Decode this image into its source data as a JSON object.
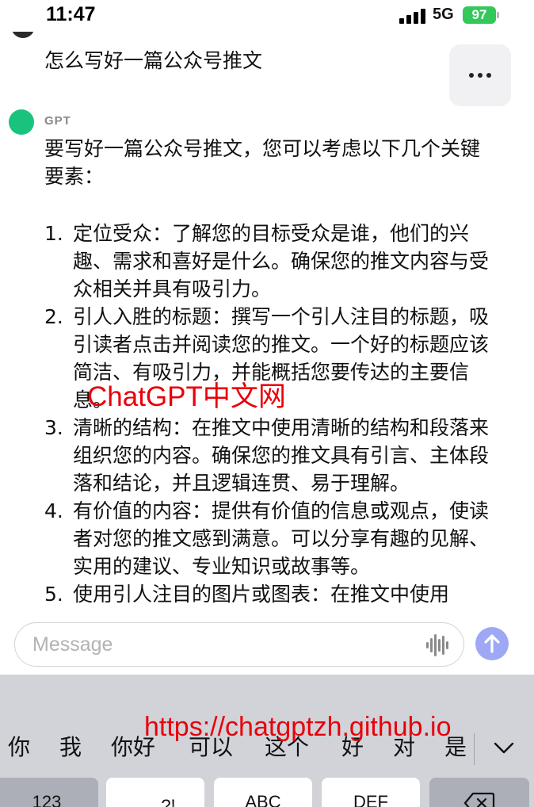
{
  "status_bar": {
    "time": "11:47",
    "network": "5G",
    "battery": "97"
  },
  "chat": {
    "user_message": "怎么写好一篇公众号推文",
    "assistant_name": "GPT",
    "assistant_intro": "要写好一篇公众号推文，您可以考虑以下几个关键要素：",
    "assistant_items": [
      {
        "number": "1.",
        "text": "定位受众：了解您的目标受众是谁，他们的兴趣、需求和喜好是什么。确保您的推文内容与受众相关并具有吸引力。"
      },
      {
        "number": "2.",
        "text": "引人入胜的标题：撰写一个引人注目的标题，吸引读者点击并阅读您的推文。一个好的标题应该简洁、有吸引力，并能概括您要传达的主要信息。"
      },
      {
        "number": "3.",
        "text": "清晰的结构：在推文中使用清晰的结构和段落来组织您的内容。确保您的推文具有引言、主体段落和结论，并且逻辑连贯、易于理解。"
      },
      {
        "number": "4.",
        "text": "有价值的内容：提供有价值的信息或观点，使读者对您的推文感到满意。可以分享有趣的见解、实用的建议、专业知识或故事等。"
      },
      {
        "number": "5.",
        "text": "使用引人注目的图片或图表：在推文中使用"
      }
    ]
  },
  "watermarks": {
    "site_name": "ChatGPT中文网",
    "url": "https://chatgptzh.github.io"
  },
  "composer": {
    "placeholder": "Message"
  },
  "keyboard": {
    "candidates": [
      "你",
      "我",
      "你好",
      "可以",
      "这个",
      "好",
      "对",
      "是"
    ],
    "keys": [
      "123",
      "，。?!",
      "ABC",
      "DEF",
      "delete"
    ]
  },
  "colors": {
    "gpt_avatar": "#19c37d",
    "send_button": "#9fa8f4",
    "battery": "#34c759",
    "watermark": "#e8000a",
    "keyboard_bg": "#d1d3d9"
  },
  "icons": {
    "more": "more-horizontal-icon",
    "voice": "voice-waveform-icon",
    "send": "arrow-up-icon",
    "expand": "chevron-down-icon",
    "delete": "backspace-icon",
    "signal": "cellular-signal-icon",
    "battery": "battery-icon"
  }
}
